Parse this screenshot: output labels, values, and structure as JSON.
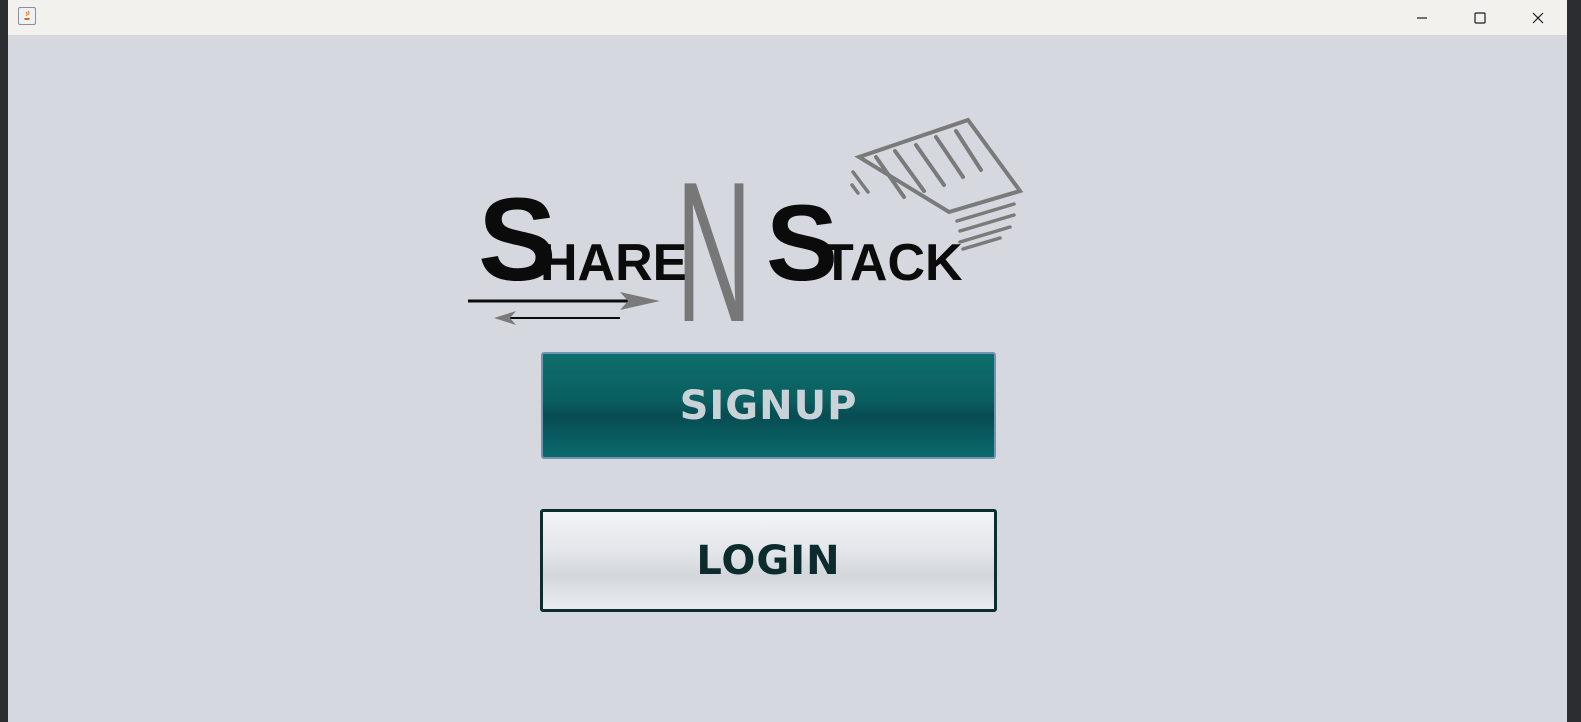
{
  "window": {
    "title": "",
    "controls": {
      "minimize_icon": "minimize-icon",
      "maximize_icon": "maximize-icon",
      "close_icon": "close-icon"
    }
  },
  "logo": {
    "text": "ShareNStack",
    "word1_initial": "S",
    "word1_rest": "HARE",
    "middle": "N",
    "word2_initial": "S",
    "word2_rest": "TACK"
  },
  "buttons": {
    "signup_label": "SIGNUP",
    "login_label": "LOGIN"
  },
  "colors": {
    "background": "#d5d8df",
    "signup_bg": "#0a5e60",
    "signup_text": "#c9d2d6",
    "login_bg": "#e3e6ea",
    "login_text": "#0b2b2d",
    "logo_dark": "#0b0b0b",
    "logo_gray": "#777777"
  }
}
